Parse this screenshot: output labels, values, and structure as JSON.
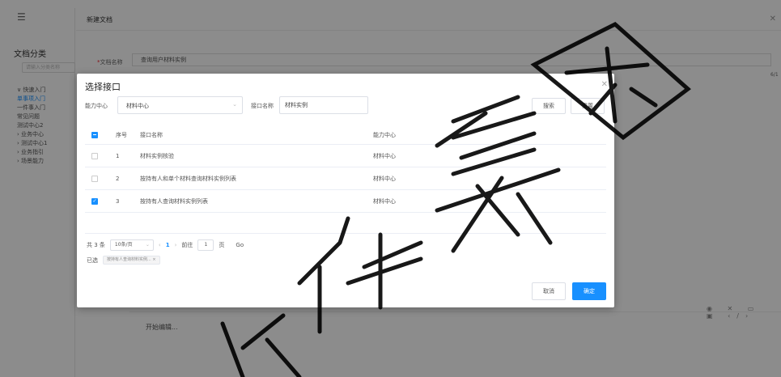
{
  "app": {
    "menu_icon": "menu-icon",
    "sidebar_title": "文档分类",
    "sidebar_search_placeholder": "请输入分类名称",
    "tree": [
      {
        "label": "∨ 快速入门",
        "active": false
      },
      {
        "label": "    单事项入门",
        "active": true
      },
      {
        "label": "    一件事入门",
        "active": false
      },
      {
        "label": "    常见问题",
        "active": false
      },
      {
        "label": "  测试中心2",
        "active": false
      },
      {
        "label": "› 业务中心",
        "active": false
      },
      {
        "label": "› 测试中心1",
        "active": false
      },
      {
        "label": "› 业务指引",
        "active": false
      },
      {
        "label": "› 场景能力",
        "active": false
      }
    ],
    "page_title": "新建文档",
    "doc_name_label": "文档名称",
    "doc_name_value": "查询用户材料实例",
    "right_count": "6/1",
    "editor_placeholder": "开始编辑...",
    "editor_tools": "◉ ✕ ▭ ▣ ‹/›"
  },
  "modal": {
    "title": "选择接口",
    "filter": {
      "center_label": "能力中心",
      "center_value": "材料中心",
      "name_label": "接口名称",
      "name_value": "材料实例",
      "search_button": "搜索",
      "reset_button": "重置"
    },
    "table": {
      "headers": {
        "index": "序号",
        "name": "接口名称",
        "center": "能力中心"
      },
      "rows": [
        {
          "index": "1",
          "name": "材料实例核验",
          "center": "材料中心",
          "checked": false
        },
        {
          "index": "2",
          "name": "按持有人和单个材料查询材料实例列表",
          "center": "材料中心",
          "checked": false
        },
        {
          "index": "3",
          "name": "按持有人查询材料实例列表",
          "center": "材料中心",
          "checked": true
        }
      ]
    },
    "pager": {
      "total": "共 3 条",
      "page_size": "10条/页",
      "prev": "‹",
      "current": "1",
      "next": "›",
      "goto_label": "前往",
      "goto_value": "1",
      "page_unit": "页",
      "go": "Go"
    },
    "selected": {
      "label": "已选",
      "tag": "按持有人查询材料实例... ×"
    },
    "cancel_button": "取消",
    "ok_button": "确定"
  },
  "colors": {
    "accent": "#1890ff",
    "overlay": "rgba(0,0,0,0.45)"
  }
}
